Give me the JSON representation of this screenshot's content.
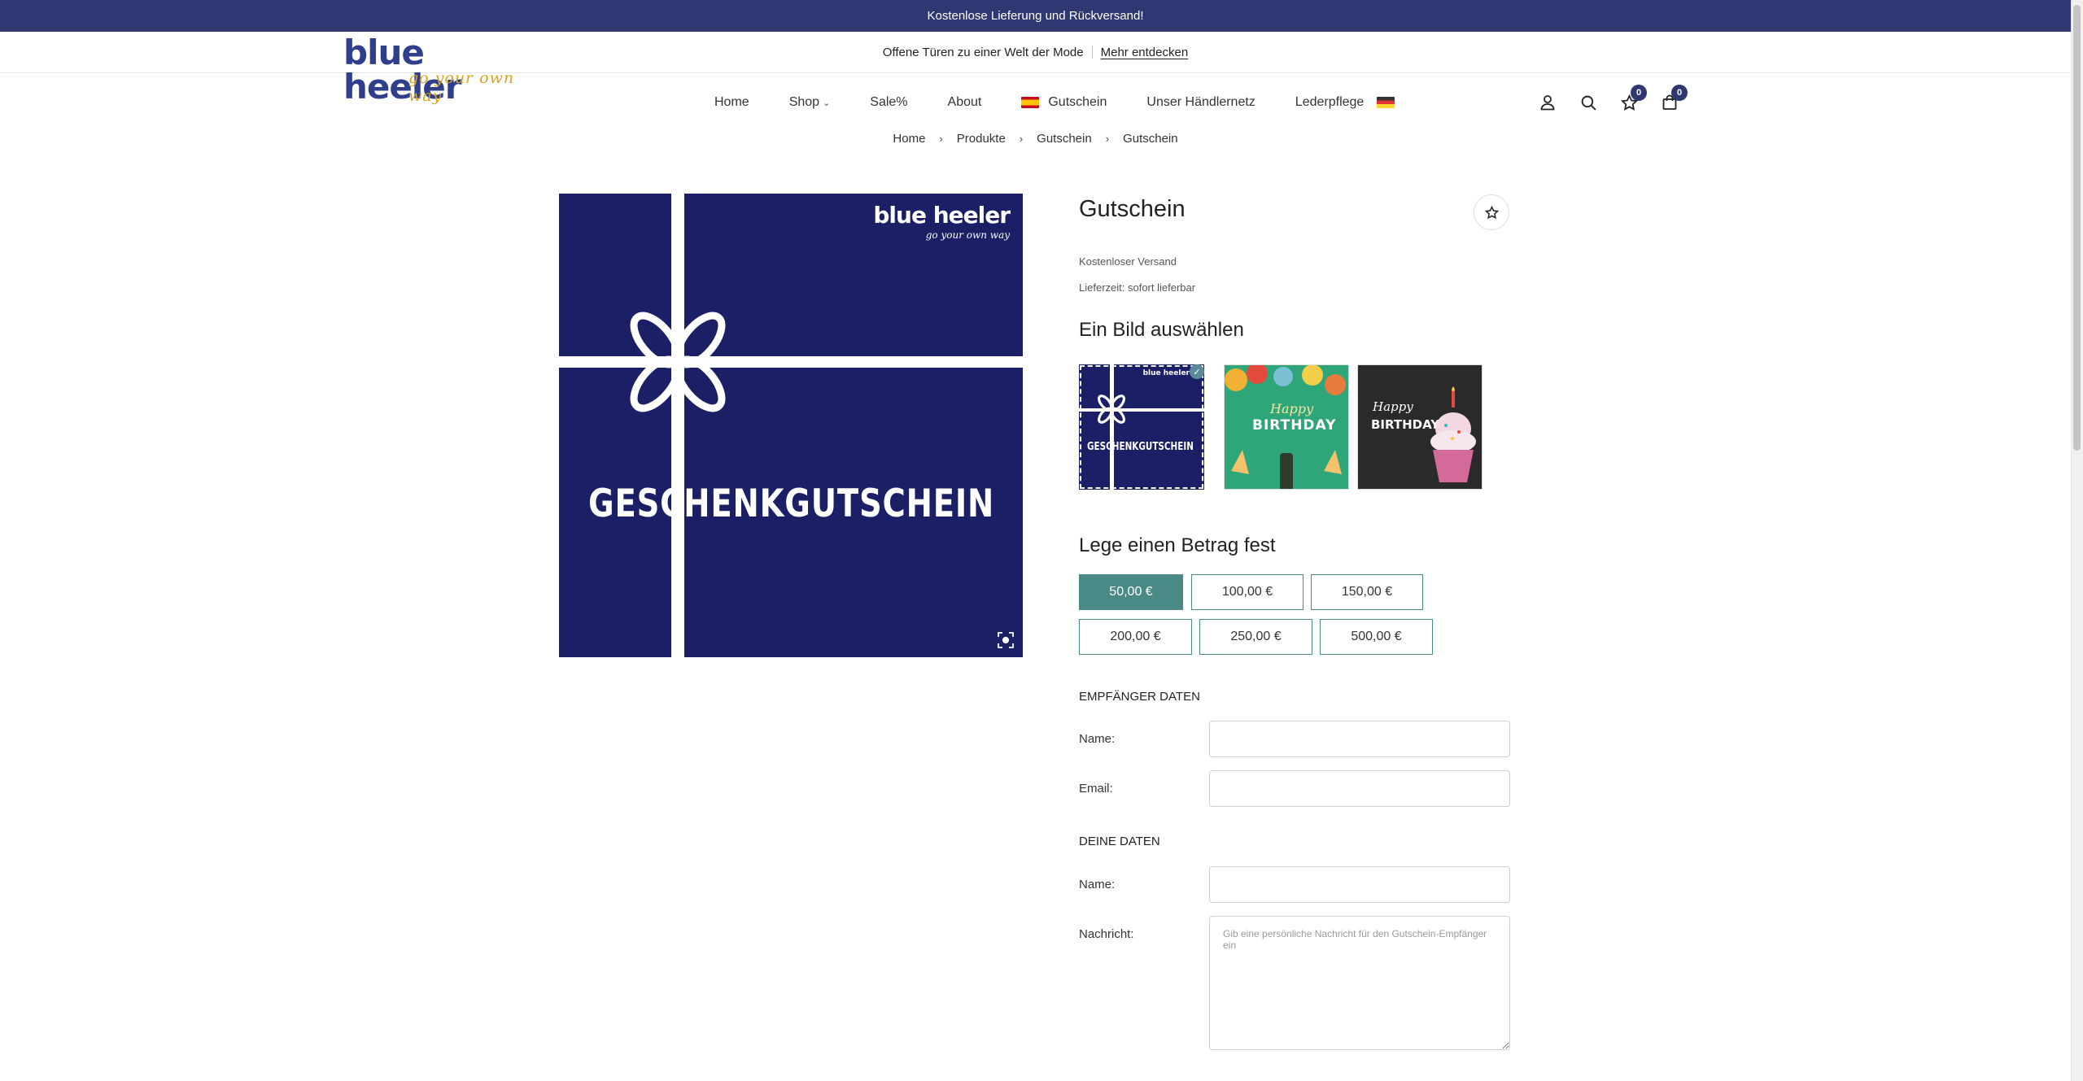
{
  "topbar": {
    "text": "Kostenlose Lieferung und Rückversand!"
  },
  "promo": {
    "text": "Offene Türen zu einer Welt der Mode",
    "link": "Mehr entdecken"
  },
  "logo": {
    "word": "blue heeler",
    "tagline": "go your own way"
  },
  "nav": {
    "items": [
      "Home",
      "Shop",
      "Sale%",
      "About",
      "Gutschein",
      "Unser Händlernetz",
      "Lederpflege"
    ],
    "flag_icon_left": "spain-flag-icon",
    "flag_icon_right": "germany-flag-icon"
  },
  "header_icons": {
    "account": "user-icon",
    "search": "search-icon",
    "wishlist": "star-icon",
    "cart": "bag-icon",
    "wishlist_count": "0",
    "cart_count": "0"
  },
  "breadcrumb": [
    "Home",
    "Produkte",
    "Gutschein",
    "Gutschein"
  ],
  "product": {
    "title": "Gutschein",
    "shipping": "Kostenloser Versand",
    "delivery": "Lieferzeit: sofort lieferbar",
    "image_text": "GESCHENKGUTSCHEIN",
    "image_brand": "blue heeler",
    "image_tagline": "go your own way"
  },
  "choose_image": {
    "heading": "Ein Bild auswählen",
    "thumbs": [
      {
        "text": "GESCHENKGUTSCHEIN",
        "brand": "blue heeler",
        "selected": true
      },
      {
        "line1": "Happy",
        "line2": "BIRTHDAY"
      },
      {
        "line1": "Happy",
        "line2": "BIRTHDAY"
      }
    ]
  },
  "amount": {
    "heading": "Lege einen Betrag fest",
    "options": [
      "50,00 €",
      "100,00 €",
      "150,00 €",
      "200,00 €",
      "250,00 €",
      "500,00 €"
    ],
    "selected": "50,00 €"
  },
  "recipient": {
    "heading": "EMPFÄNGER DATEN",
    "name_label": "Name:",
    "email_label": "Email:"
  },
  "sender": {
    "heading": "DEINE DATEN",
    "name_label": "Name:",
    "message_label": "Nachricht:",
    "message_placeholder": "Gib eine persönliche Nachricht für den Gutschein-Empfänger ein"
  },
  "colors": {
    "brand_navy": "#2f3870",
    "accent_teal": "#4a8a86",
    "logo_gold": "#d9a21b"
  }
}
